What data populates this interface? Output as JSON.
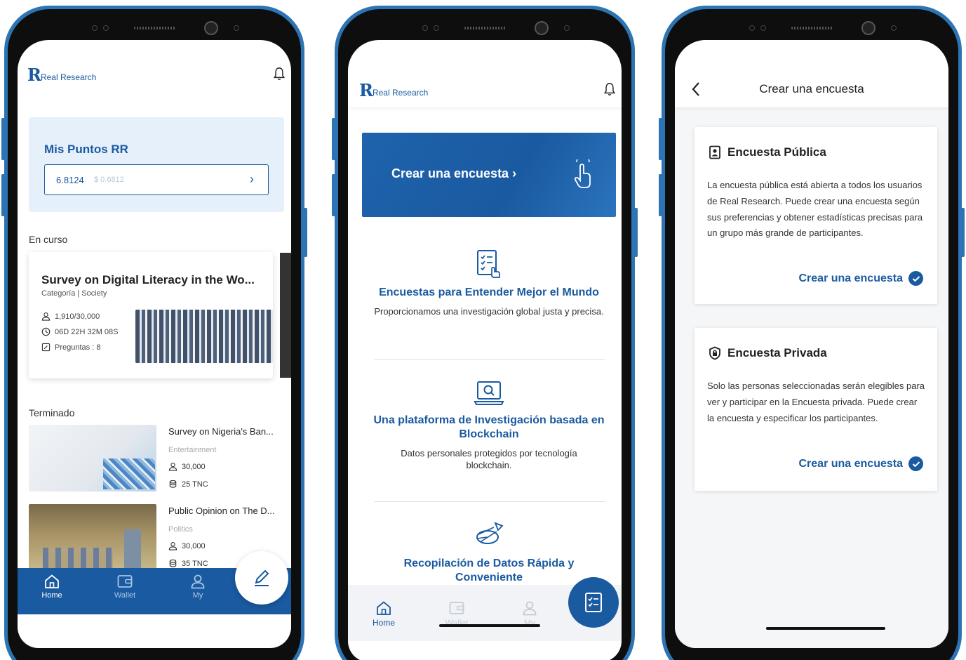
{
  "brand": {
    "logo_mark": "R",
    "logo_text": "Real Research"
  },
  "colors": {
    "brand_blue": "#1a5aa0",
    "phone_frame": "#2c74b3",
    "light_blue_bg": "#e6f0fa"
  },
  "phone1": {
    "points": {
      "title": "Mis Puntos RR",
      "value": "6.8124",
      "usd": "$ 0.6812"
    },
    "ongoing": {
      "section_label": "En curso",
      "card": {
        "title": "Survey on Digital Literacy in the Wo...",
        "category": "Categoría | Society",
        "participants": "1,910/30,000",
        "time_left": "06D 22H 32M 08S",
        "questions": "Preguntas : 8"
      }
    },
    "finished": {
      "section_label": "Terminado",
      "items": [
        {
          "title": "Survey on Nigeria's Ban...",
          "category": "Entertainment",
          "participants": "30,000",
          "reward": "25 TNC"
        },
        {
          "title": "Public Opinion on The D...",
          "category": "Politics",
          "participants": "30,000",
          "reward": "35 TNC"
        }
      ]
    },
    "tabs": [
      {
        "label": "Home",
        "icon": "home-icon"
      },
      {
        "label": "Wallet",
        "icon": "wallet-icon"
      },
      {
        "label": "My",
        "icon": "user-icon"
      }
    ]
  },
  "phone2": {
    "banner": {
      "label": "Crear una encuesta ›"
    },
    "features": [
      {
        "title": "Encuestas para Entender Mejor el Mundo",
        "desc": "Proporcionamos una investigación global justa y precisa."
      },
      {
        "title": "Una plataforma de Investigación basada en Blockchain",
        "desc": "Datos personales protegidos por tecnología blockchain."
      },
      {
        "title": "Recopilación de Datos Rápida y Conveniente",
        "desc": ""
      }
    ],
    "tabs": [
      {
        "label": "Home",
        "icon": "home-icon"
      },
      {
        "label": "Wallet",
        "icon": "wallet-icon"
      },
      {
        "label": "My",
        "icon": "user-icon"
      }
    ]
  },
  "phone3": {
    "title": "Crear una encuesta",
    "cards": [
      {
        "heading": "Encuesta Pública",
        "desc": "La encuesta pública está abierta a todos los usuarios de Real Research. Puede crear una encuesta según sus preferencias y obtener estadísticas precisas para un grupo más grande de participantes.",
        "link": "Crear una encuesta"
      },
      {
        "heading": "Encuesta Privada",
        "desc": "Solo las personas seleccionadas serán elegibles para ver y participar en la Encuesta privada. Puede crear la encuesta y especificar los participantes.",
        "link": "Crear una encuesta"
      }
    ]
  }
}
